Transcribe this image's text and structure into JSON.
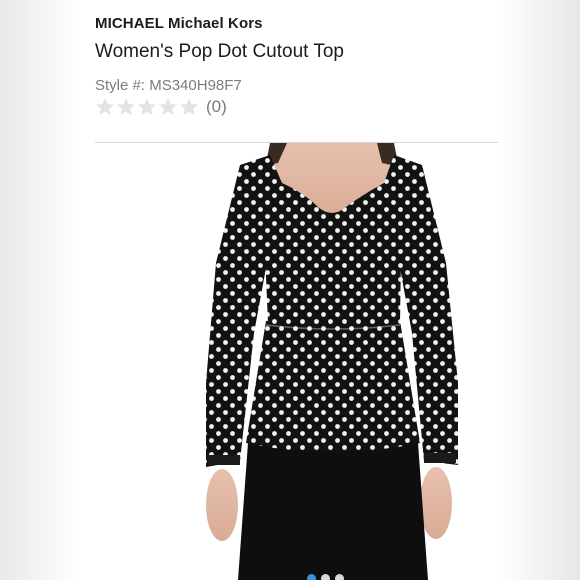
{
  "product": {
    "brand": "MICHAEL Michael Kors",
    "name": "Women's Pop Dot Cutout Top",
    "style_label": "Style #:",
    "style_number": "MS340H98F7",
    "rating": {
      "stars_filled": 0,
      "stars_total": 5,
      "review_count_text": "(0)"
    }
  },
  "gallery": {
    "image_icon": "product-photo",
    "slide_count": 3,
    "active_slide": 1
  },
  "colors": {
    "brand_text": "#1c1c1c",
    "muted_text": "#7d7d7d",
    "star_empty": "#e3e3e3",
    "divider": "#d6d6d6",
    "pager_active": "#3d8fd6",
    "pager_inactive": "#d9d9d9"
  }
}
